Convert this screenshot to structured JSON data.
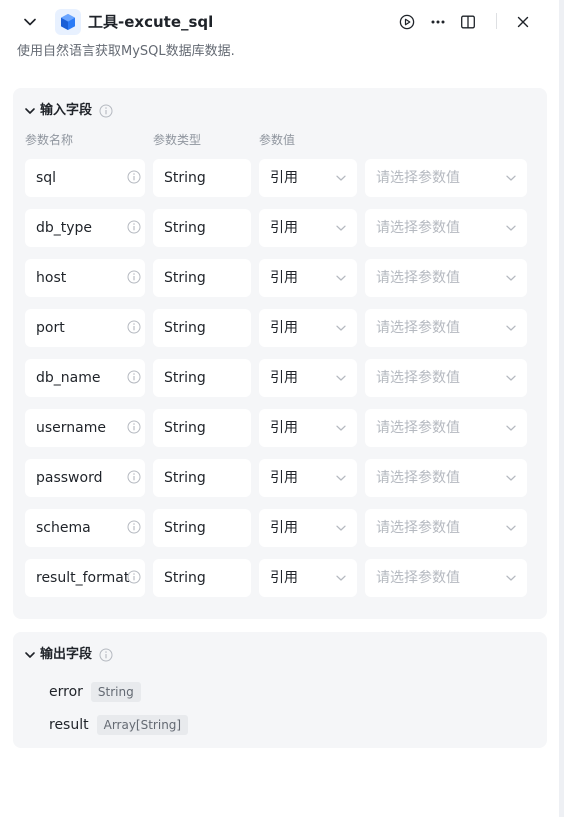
{
  "header": {
    "title": "工具-excute_sql",
    "description": "使用自然语言获取MySQL数据库数据."
  },
  "input_section": {
    "title": "输入字段",
    "columns": {
      "name": "参数名称",
      "type": "参数类型",
      "value": "参数值"
    },
    "rows": [
      {
        "name": "sql",
        "type": "String",
        "source": "引用",
        "value_placeholder": "请选择参数值"
      },
      {
        "name": "db_type",
        "type": "String",
        "source": "引用",
        "value_placeholder": "请选择参数值"
      },
      {
        "name": "host",
        "type": "String",
        "source": "引用",
        "value_placeholder": "请选择参数值"
      },
      {
        "name": "port",
        "type": "String",
        "source": "引用",
        "value_placeholder": "请选择参数值"
      },
      {
        "name": "db_name",
        "type": "String",
        "source": "引用",
        "value_placeholder": "请选择参数值"
      },
      {
        "name": "username",
        "type": "String",
        "source": "引用",
        "value_placeholder": "请选择参数值"
      },
      {
        "name": "password",
        "type": "String",
        "source": "引用",
        "value_placeholder": "请选择参数值"
      },
      {
        "name": "schema",
        "type": "String",
        "source": "引用",
        "value_placeholder": "请选择参数值"
      },
      {
        "name": "result_format",
        "type": "String",
        "source": "引用",
        "value_placeholder": "请选择参数值"
      }
    ]
  },
  "output_section": {
    "title": "输出字段",
    "fields": [
      {
        "name": "error",
        "type": "String"
      },
      {
        "name": "result",
        "type": "Array[String]"
      }
    ]
  },
  "colors": {
    "card_bg": "#f5f6f8",
    "text_primary": "#1f2329",
    "text_secondary": "#646a73",
    "placeholder": "#b5b9c0",
    "logo_accent": "#2b7bf6"
  },
  "icons": {
    "collapse": "chevron-down-icon",
    "logo": "tool-cube-icon",
    "run": "play-circle-icon",
    "more": "more-horizontal-icon",
    "split": "split-view-icon",
    "close": "close-icon",
    "info": "info-circle-icon"
  }
}
